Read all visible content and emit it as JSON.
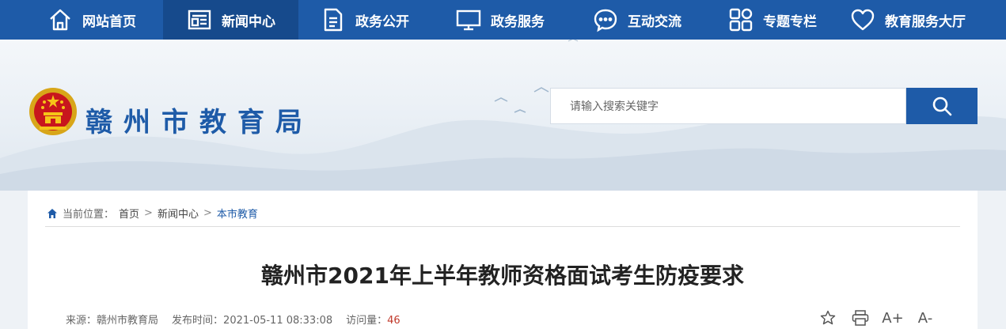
{
  "nav": {
    "items": [
      {
        "label": "网站首页",
        "icon": "home-icon",
        "active": false
      },
      {
        "label": "新闻中心",
        "icon": "newspaper-icon",
        "active": true
      },
      {
        "label": "政务公开",
        "icon": "document-icon",
        "active": false
      },
      {
        "label": "政务服务",
        "icon": "monitor-icon",
        "active": false
      },
      {
        "label": "互动交流",
        "icon": "chat-icon",
        "active": false
      },
      {
        "label": "专题专栏",
        "icon": "grid-icon",
        "active": false
      },
      {
        "label": "教育服务大厅",
        "icon": "heart-icon",
        "active": false
      }
    ]
  },
  "header": {
    "site_title": "赣州市教育局",
    "search_placeholder": "请输入搜索关键字"
  },
  "breadcrumb": {
    "prefix": "当前位置：",
    "items": [
      "首页",
      "新闻中心",
      "本市教育"
    ],
    "separator": ">"
  },
  "article": {
    "title": "赣州市2021年上半年教师资格面试考生防疫要求",
    "source_label": "来源：",
    "source": "赣州市教育局",
    "time_label": "发布时间：",
    "time": "2021-05-11 08:33:08",
    "views_label": "访问量：",
    "views": "46"
  },
  "tools": {
    "enlarge": "A+",
    "shrink": "A-"
  },
  "colors": {
    "nav_bg": "#1e5ba8",
    "nav_active": "#164a8c",
    "title_blue": "#1e5ba8",
    "views_red": "#c0392b"
  }
}
